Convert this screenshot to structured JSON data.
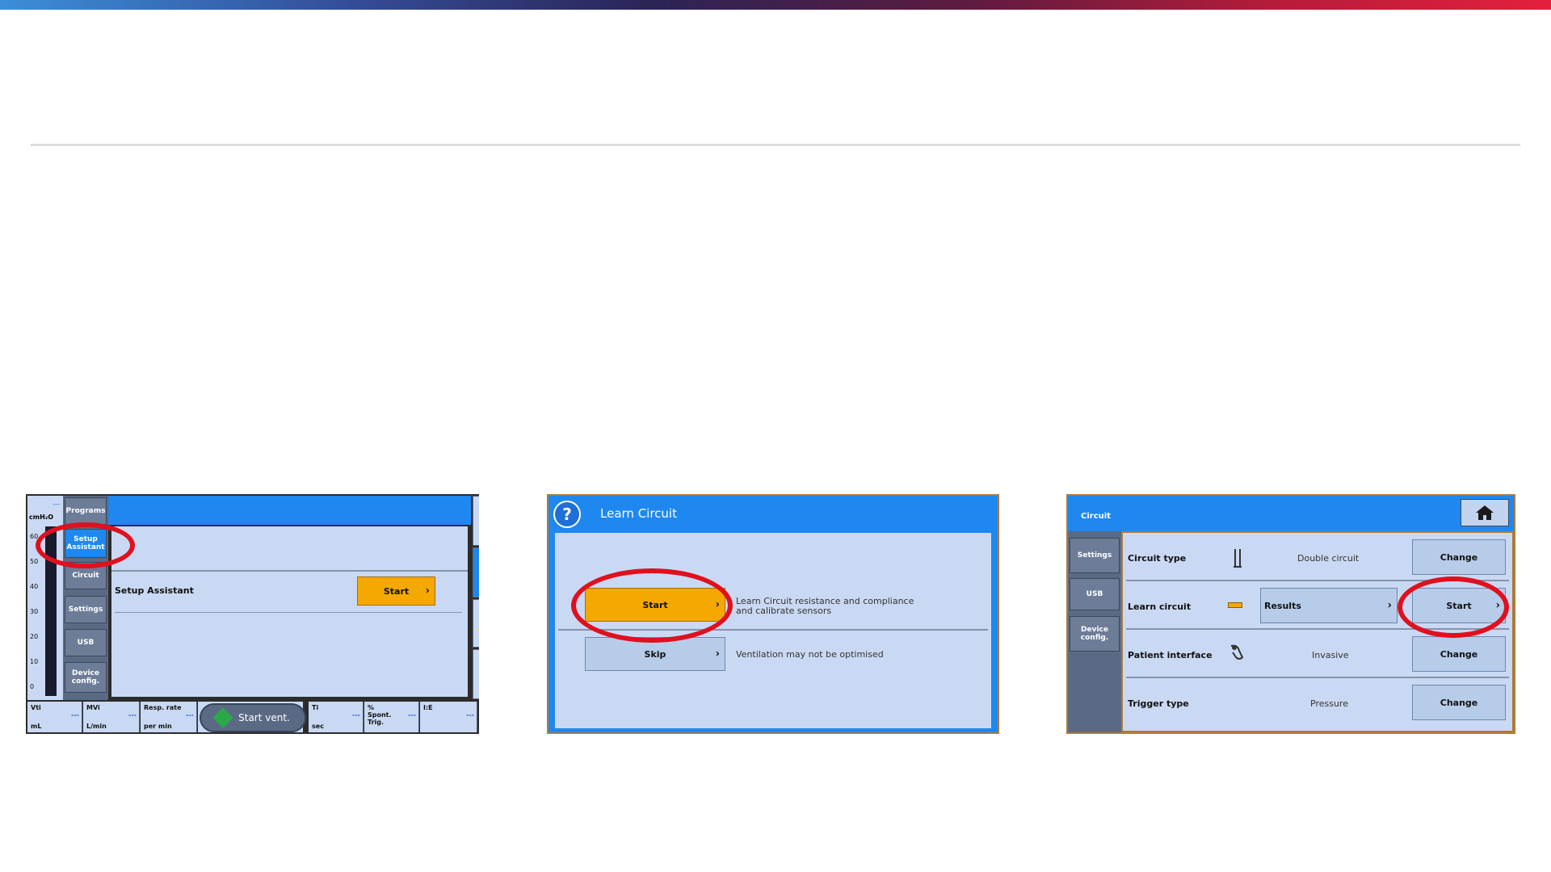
{
  "screen1": {
    "pressure_unit": "cmH₂O",
    "scale_ticks": [
      "60",
      "50",
      "40",
      "30",
      "20",
      "10",
      "0"
    ],
    "sidebar": [
      "Programs",
      "Setup Assistant",
      "Circuit",
      "Settings",
      "USB",
      "Device config."
    ],
    "row_label": "Setup Assistant",
    "start_label": "Start",
    "footer": [
      {
        "name": "Vti",
        "unit": "mL",
        "value": "---"
      },
      {
        "name": "MVi",
        "unit": "L/min",
        "value": "---"
      },
      {
        "name": "Resp. rate",
        "unit": "per min",
        "value": "---"
      },
      {
        "name": "Ti",
        "unit": "sec",
        "value": "---"
      },
      {
        "name": "% Spont. Trig.",
        "unit": "",
        "value": "---"
      },
      {
        "name": "I:E",
        "unit": "",
        "value": "---"
      }
    ],
    "start_vent": "Start vent.",
    "dashes": "---",
    "icons": [
      "lungs-icon",
      "checklist-icon",
      "bell-icon",
      "info-icon"
    ]
  },
  "screen2": {
    "title": "Learn Circuit",
    "start_label": "Start",
    "start_desc_1": "Learn Circuit resistance and compliance",
    "start_desc_2": "and calibrate sensors",
    "skip_label": "Skip",
    "skip_desc": "Ventilation may not be optimised"
  },
  "screen3": {
    "tab": "Circuit",
    "sidebar": [
      "Settings",
      "USB",
      "Device config."
    ],
    "rows": [
      {
        "label": "Circuit type",
        "value": "Double circuit",
        "button": "Change"
      },
      {
        "label": "Learn circuit",
        "value": "Results",
        "button": "Start"
      },
      {
        "label": "Patient interface",
        "value": "Invasive",
        "button": "Change"
      },
      {
        "label": "Trigger type",
        "value": "Pressure",
        "button": "Change"
      }
    ]
  },
  "colors": {
    "accent_blue": "#1e88f0",
    "highlight_red": "#e0101e",
    "start_orange": "#f5a800"
  }
}
